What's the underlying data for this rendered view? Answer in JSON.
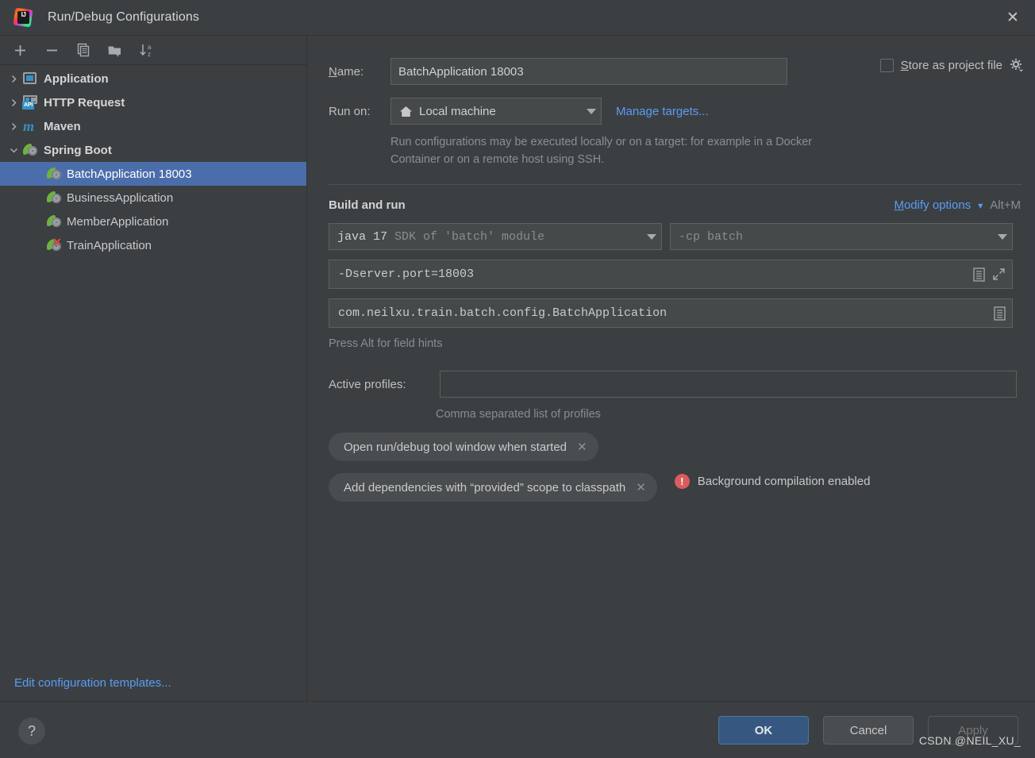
{
  "window": {
    "title": "Run/Debug Configurations",
    "logo_icon": "intellij-idea-logo",
    "close_icon": "close-icon"
  },
  "toolbar": {
    "buttons": [
      {
        "name": "add-configuration",
        "icon": "plus-icon"
      },
      {
        "name": "remove-configuration",
        "icon": "minus-icon"
      },
      {
        "name": "copy-configuration",
        "icon": "copy-icon"
      },
      {
        "name": "new-folder",
        "icon": "folder-add-icon"
      },
      {
        "name": "sort-configurations",
        "icon": "sort-az-icon"
      }
    ]
  },
  "sidebar": {
    "items": [
      {
        "label": "Application",
        "icon": "application-icon",
        "expandable": true,
        "expanded": false,
        "level": 0,
        "selected": false,
        "error": false
      },
      {
        "label": "HTTP Request",
        "icon": "http-request-icon",
        "expandable": true,
        "expanded": false,
        "level": 0,
        "selected": false,
        "error": false
      },
      {
        "label": "Maven",
        "icon": "maven-icon",
        "expandable": true,
        "expanded": false,
        "level": 0,
        "selected": false,
        "error": false
      },
      {
        "label": "Spring Boot",
        "icon": "spring-boot-icon",
        "expandable": true,
        "expanded": true,
        "level": 0,
        "selected": false,
        "error": false
      },
      {
        "label": "BatchApplication 18003",
        "icon": "spring-boot-icon",
        "expandable": false,
        "expanded": false,
        "level": 1,
        "selected": true,
        "error": false
      },
      {
        "label": "BusinessApplication",
        "icon": "spring-boot-icon",
        "expandable": false,
        "expanded": false,
        "level": 1,
        "selected": false,
        "error": false
      },
      {
        "label": "MemberApplication",
        "icon": "spring-boot-icon",
        "expandable": false,
        "expanded": false,
        "level": 1,
        "selected": false,
        "error": false
      },
      {
        "label": "TrainApplication",
        "icon": "spring-boot-icon",
        "expandable": false,
        "expanded": false,
        "level": 1,
        "selected": false,
        "error": true
      }
    ],
    "edit_templates_link": "Edit configuration templates..."
  },
  "form": {
    "name_label": "Name:",
    "name_value": "BatchApplication 18003",
    "store_as_project_file_label": "Store as project file",
    "store_as_project_file_checked": false,
    "store_gear_icon": "gear-icon",
    "run_on_label": "Run on:",
    "run_on_value": "Local machine",
    "run_on_icon": "home-icon",
    "manage_targets_link": "Manage targets...",
    "run_on_hint": "Run configurations may be executed locally or on a target: for example in a Docker Container or on a remote host using SSH."
  },
  "build_and_run": {
    "section_title": "Build and run",
    "modify_options_link": "Modify options",
    "modify_options_shortcut": "Alt+M",
    "sdk_value": "java 17",
    "sdk_value_dim": "SDK of 'batch' module",
    "classpath_value": "-cp batch",
    "vm_options_value": "-Dserver.port=18003",
    "vm_options_icons": [
      "document-icon",
      "expand-icon"
    ],
    "main_class_value": "com.neilxu.train.batch.config.BatchApplication",
    "main_class_icons": [
      "document-icon"
    ],
    "press_alt_hint": "Press Alt for field hints"
  },
  "spring_section": {
    "active_profiles_label": "Active profiles:",
    "active_profiles_value": "",
    "active_profiles_hint": "Comma separated list of profiles",
    "chips": [
      {
        "label": "Open run/debug tool window when started",
        "close_icon": "close-icon"
      },
      {
        "label": "Add dependencies with “provided” scope to classpath",
        "close_icon": "close-icon"
      }
    ],
    "warning": {
      "icon": "error-circle-icon",
      "text": "Background compilation enabled"
    }
  },
  "footer": {
    "help_label": "?",
    "ok_label": "OK",
    "cancel_label": "Cancel",
    "apply_label": "Apply",
    "apply_enabled": false
  },
  "watermark": "CSDN @NEIL_XU_",
  "colors": {
    "background": "#3c3f41",
    "selection_blue": "#4b6eab",
    "link_blue": "#589df6",
    "ok_button": "#365880",
    "error_red": "#db5c5c",
    "spring_green": "#6cb33f",
    "accent_teal": "#3592c4"
  }
}
